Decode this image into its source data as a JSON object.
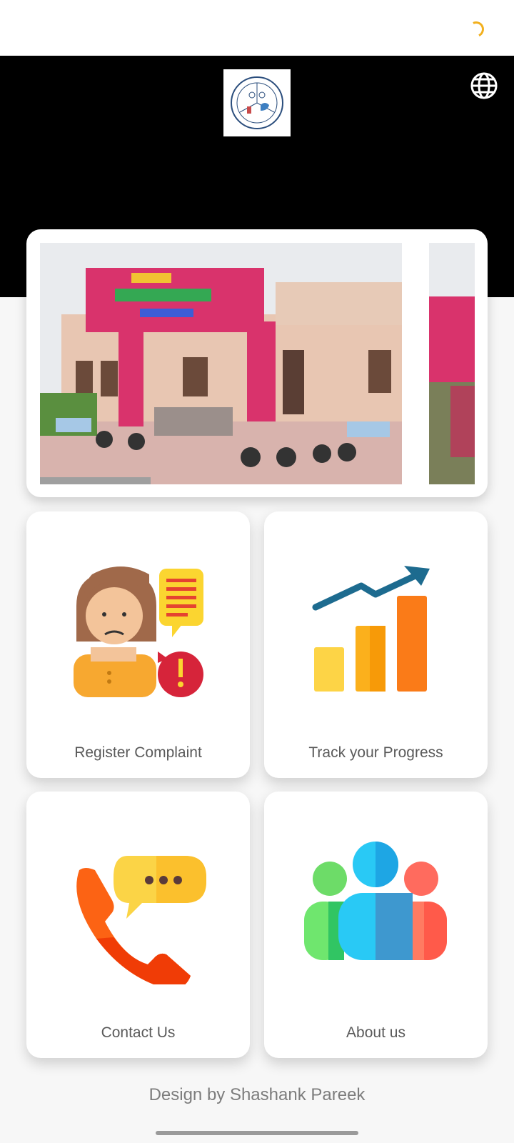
{
  "header": {
    "logo_icon": "municipal-seal-logo",
    "language_icon": "globe-icon",
    "bg_color": "#000000"
  },
  "carousel": {
    "slides": [
      "office-building-photo",
      "office-building-photo-partial"
    ]
  },
  "menu": {
    "register_complaint": "Register Complaint",
    "track_progress": "Track your Progress",
    "contact_us": "Contact Us",
    "about_us": "About us"
  },
  "footer": {
    "credit": "Design by Shashank Pareek"
  }
}
